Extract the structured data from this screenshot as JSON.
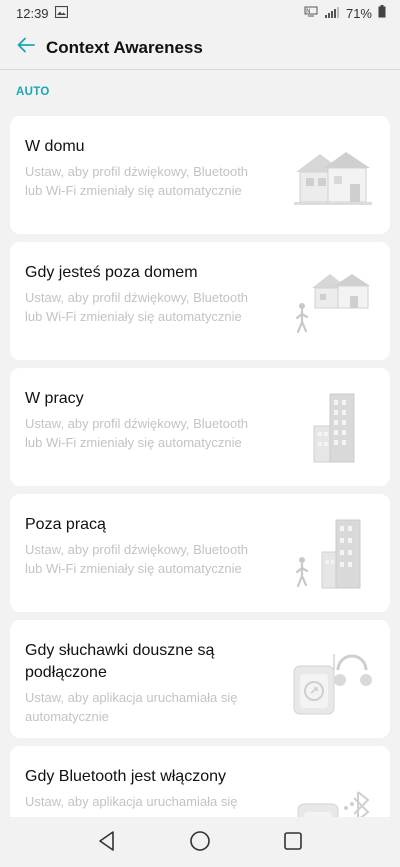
{
  "status_bar": {
    "time": "12:39",
    "battery": "71%",
    "icons": [
      "image-icon",
      "nfc-icon",
      "signal-icon",
      "battery-icon"
    ]
  },
  "app_bar": {
    "title": "Context Awareness",
    "back_icon": "arrow-left-icon"
  },
  "section": {
    "label": "AUTO"
  },
  "cards": [
    {
      "title": "W domu",
      "desc": "Ustaw, aby profil dźwiękowy, Bluetooth lub Wi-Fi zmieniały się automatycznie",
      "art": "house-icon"
    },
    {
      "title": "Gdy jesteś poza domem",
      "desc": "Ustaw, aby profil dźwiękowy, Bluetooth lub Wi-Fi zmieniały się automatycznie",
      "art": "house-walking-person-icon"
    },
    {
      "title": "W pracy",
      "desc": "Ustaw, aby profil dźwiękowy, Bluetooth lub Wi-Fi zmieniały się automatycznie",
      "art": "office-building-icon"
    },
    {
      "title": "Poza pracą",
      "desc": "Ustaw, aby profil dźwiękowy, Bluetooth lub Wi-Fi zmieniały się automatycznie",
      "art": "building-walking-person-icon"
    },
    {
      "title": "Gdy słuchawki douszne są podłączone",
      "desc": "Ustaw, aby aplikacja uruchamiała się automatycznie",
      "art": "headphones-phone-icon"
    },
    {
      "title": "Gdy Bluetooth jest włączony",
      "desc": "Ustaw, aby aplikacja uruchamiała się",
      "art": "bluetooth-phone-icon"
    }
  ],
  "nav_bar": {
    "icons": [
      "back-triangle-icon",
      "home-circle-icon",
      "recents-square-icon"
    ]
  },
  "colors": {
    "accent": "#1aa6b7",
    "background": "#f2f2f2",
    "card": "#ffffff",
    "desc_text": "#c3c3c3"
  }
}
